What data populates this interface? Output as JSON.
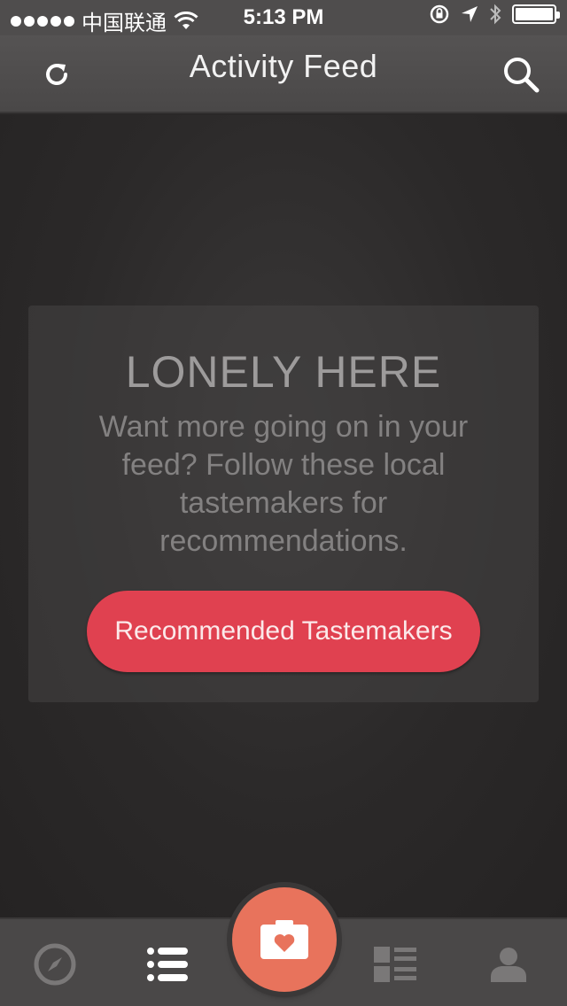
{
  "status_bar": {
    "carrier": "中国联通",
    "time": "5:13 PM"
  },
  "nav": {
    "title": "Activity Feed"
  },
  "empty_state": {
    "title": "LONELY HERE",
    "message": "Want more going on in your feed? Follow these local tastemakers for recommendations.",
    "button_label": "Recommended Tastemakers"
  },
  "tabs": [
    {
      "icon": "compass-icon",
      "active": false
    },
    {
      "icon": "list-icon",
      "active": true
    },
    {
      "icon": "camera-heart-icon",
      "active": false
    },
    {
      "icon": "grid-list-icon",
      "active": false
    },
    {
      "icon": "person-icon",
      "active": false
    }
  ],
  "colors": {
    "accent": "#e04150",
    "camera": "#e8735c",
    "bar": "#4a4848",
    "background": "#2a2828"
  }
}
